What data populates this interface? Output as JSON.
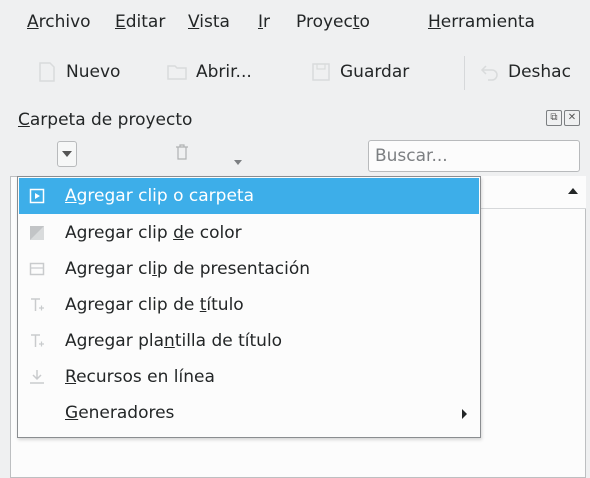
{
  "menubar": {
    "items": [
      {
        "pre": "",
        "mn": "A",
        "post": "rchivo"
      },
      {
        "pre": "",
        "mn": "E",
        "post": "ditar"
      },
      {
        "pre": "",
        "mn": "V",
        "post": "ista"
      },
      {
        "pre": "",
        "mn": "I",
        "post": "r"
      },
      {
        "pre": "Proyec",
        "mn": "t",
        "post": "o"
      },
      {
        "pre": "",
        "mn": "H",
        "post": "erramienta"
      }
    ]
  },
  "toolbar": {
    "new_label": "Nuevo",
    "open_label": "Abrir...",
    "save_label": "Guardar",
    "undo_label": "Deshac"
  },
  "panel": {
    "title_mn": "C",
    "title_rest": "arpeta de proyecto",
    "search_placeholder": "Buscar..."
  },
  "menu": {
    "items": [
      {
        "pre": "",
        "mn": "A",
        "post": "gregar clip o carpeta",
        "icon": "add-clip-icon",
        "selected": true
      },
      {
        "pre": "Agregar clip ",
        "mn": "d",
        "post": "e color",
        "icon": "color-clip-icon"
      },
      {
        "pre": "Agregar cl",
        "mn": "i",
        "post": "p de presentación",
        "icon": "slideshow-clip-icon"
      },
      {
        "pre": "Agregar clip de ",
        "mn": "t",
        "post": "ítulo",
        "icon": "title-clip-icon"
      },
      {
        "pre": "Agregar pla",
        "mn": "n",
        "post": "tilla de título",
        "icon": "title-template-icon"
      },
      {
        "pre": "",
        "mn": "R",
        "post": "ecursos en línea",
        "icon": "download-icon"
      },
      {
        "pre": "",
        "mn": "G",
        "post": "eneradores",
        "icon": "",
        "submenu": true
      }
    ]
  },
  "colors": {
    "accent": "#3daee9",
    "window_bg": "#eff0f1",
    "view_bg": "#fcfcfc"
  }
}
